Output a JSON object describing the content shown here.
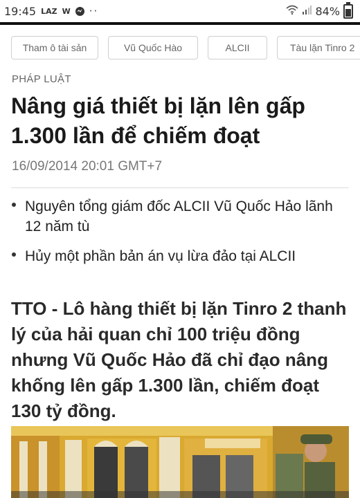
{
  "status_bar": {
    "time": "19:45",
    "app_icons": [
      "LAZ",
      "W"
    ],
    "more": "··",
    "battery": "84%"
  },
  "tags": [
    "Tham ô tài sản",
    "Vũ Quốc Hào",
    "ALCII",
    "Tàu lặn Tinro 2"
  ],
  "article": {
    "category": "PHÁP LUẬT",
    "title": "Nâng giá thiết bị lặn lên gấp 1.300 lần để chiếm đoạt",
    "date": "16/09/2014 20:01 GMT+7",
    "related": [
      "Nguyên tổng giám đốc ALCII Vũ Quốc Hảo lãnh 12 năm tù",
      "Hủy một phần bản án vụ lừa đảo tại ALCII"
    ],
    "lead": "TTO - Lô hàng thiết bị lặn Tinro 2 thanh lý của hải quan chỉ 100 triệu đồng nhưng Vũ Quốc Hảo đã chỉ đạo nâng khống lên gấp 1.300 lần, chiếm đoạt 130 tỷ đồng."
  },
  "battery_level": 0.84,
  "icons": [
    "wifi-icon",
    "signal-icon",
    "battery-icon",
    "messenger-icon"
  ],
  "colors": {
    "photo_wall": "#e3b53a",
    "photo_pillar": "#ece2c2"
  }
}
